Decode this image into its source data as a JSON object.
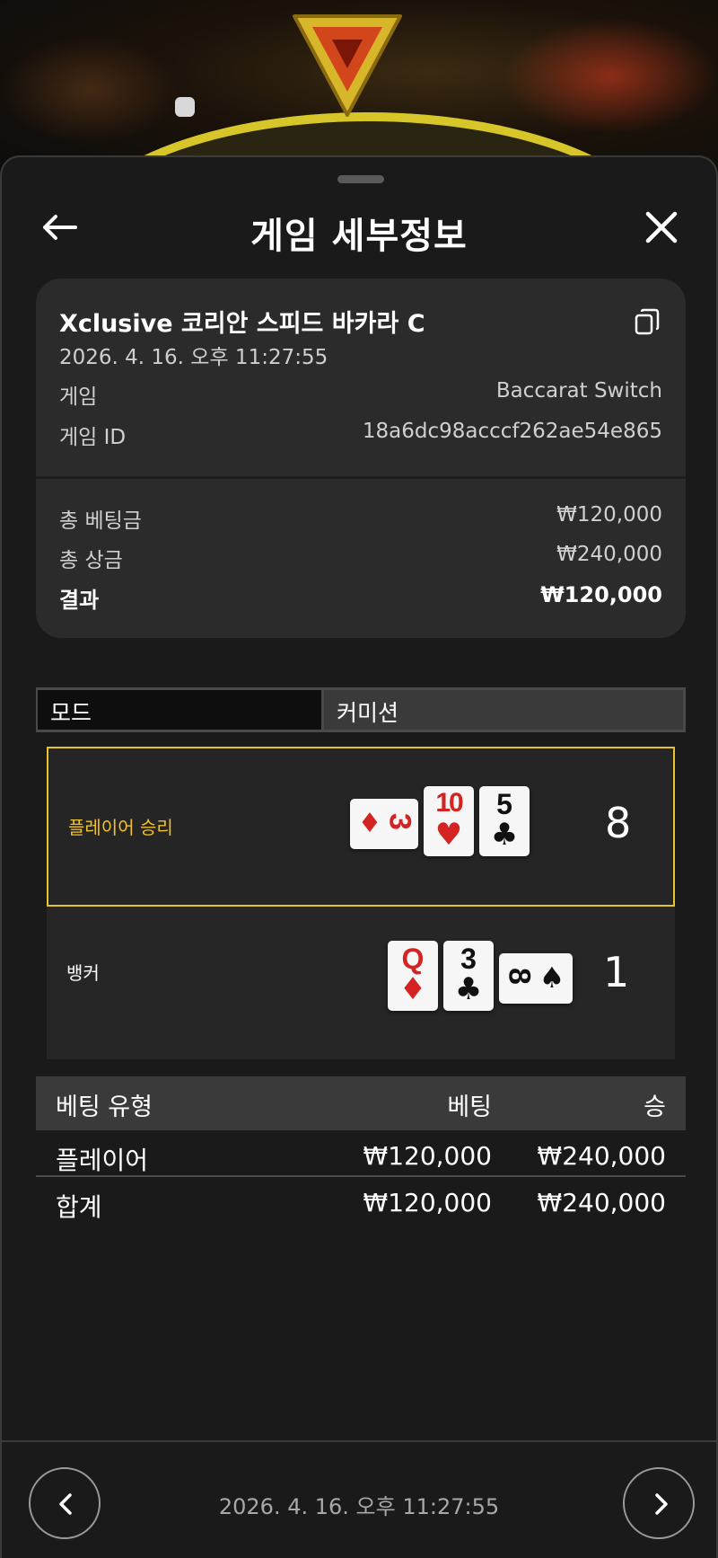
{
  "header": {
    "title": "게임 세부정보"
  },
  "summary": {
    "table_name": "Xclusive 코리안 스피드 바카라 C",
    "datetime": "2026. 4. 16. 오후 11:27:55",
    "game_label": "게임",
    "game_value": "Baccarat Switch",
    "game_id_label": "게임 ID",
    "game_id_value": "18a6dc98acccf262ae54e865",
    "total_bet_label": "총 베팅금",
    "total_bet_value": "₩120,000",
    "total_win_label": "총 상금",
    "total_win_value": "₩240,000",
    "result_label": "결과",
    "result_value": "₩120,000"
  },
  "tabs": {
    "mode": "모드",
    "commission": "커미션"
  },
  "results": {
    "player": {
      "label": "플레이어 승리",
      "score": "8",
      "cards": [
        {
          "rank": "3",
          "suit": "♦",
          "color": "red",
          "orientation": "sideways"
        },
        {
          "rank": "10",
          "suit": "♥",
          "color": "red",
          "orientation": "upright"
        },
        {
          "rank": "5",
          "suit": "♣",
          "color": "black",
          "orientation": "upright"
        }
      ]
    },
    "banker": {
      "label": "뱅커",
      "score": "1",
      "cards": [
        {
          "rank": "Q",
          "suit": "♦",
          "color": "red",
          "orientation": "upright"
        },
        {
          "rank": "3",
          "suit": "♣",
          "color": "black",
          "orientation": "upright"
        },
        {
          "rank": "8",
          "suit": "♠",
          "color": "black",
          "orientation": "sideways"
        }
      ]
    }
  },
  "bets": {
    "columns": {
      "type": "베팅 유형",
      "bet": "베팅",
      "win": "승"
    },
    "rows": [
      {
        "type": "플레이어",
        "bet": "₩120,000",
        "win": "₩240,000"
      }
    ],
    "total": {
      "type": "합계",
      "bet": "₩120,000",
      "win": "₩240,000"
    }
  },
  "footer": {
    "datetime": "2026. 4. 16. 오후 11:27:55"
  },
  "colors": {
    "accent": "#f2c12b",
    "card_red": "#d42323",
    "sheet_bg": "#1a1a1a",
    "panel_bg": "#2b2b2b"
  }
}
